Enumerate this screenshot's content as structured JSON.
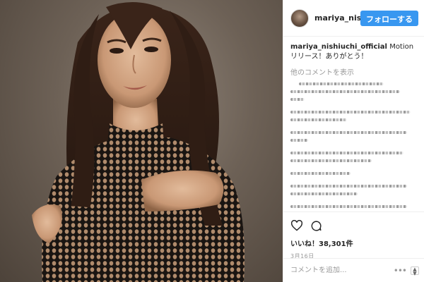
{
  "post": {
    "username": "mariya_nishiuchi_official",
    "follow_label": "フォローする",
    "caption_user": "mariya_nishiuchi_official",
    "caption_text": "Motion リリース！ありがとう！",
    "more_comments": "他のコメントを表示",
    "likes": "いいね！38,301件",
    "date": "3月16日",
    "comment_placeholder": "コメントを追加...",
    "more_options": "•••"
  },
  "icons": {
    "like": "heart-icon",
    "comment": "comment-bubble-icon",
    "options": "more-options-icon"
  },
  "colors": {
    "accent": "#3897f0",
    "text": "#262626",
    "muted": "#999999",
    "border": "#efefef"
  }
}
